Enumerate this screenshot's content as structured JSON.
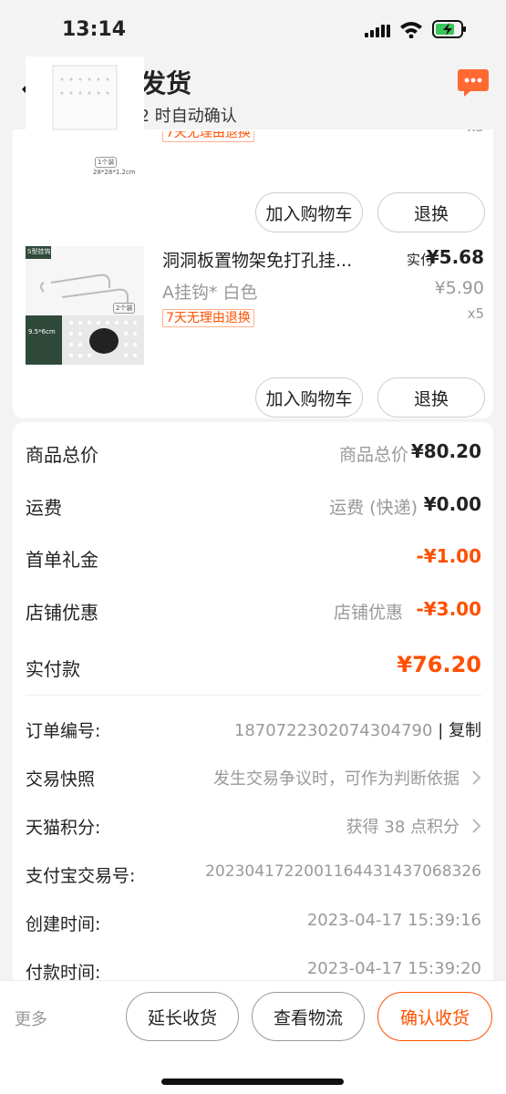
{
  "status_bar": {
    "time": "13:14"
  },
  "header": {
    "title": "卖家已发货",
    "subtitle": "还剩 9 天 2 时自动确认"
  },
  "items": [
    {
      "tag": "7天无理由退换",
      "qty": "x5",
      "thumb_caption_1": "1个装",
      "thumb_caption_2": "28*28*1.2cm",
      "add_cart": "加入购物车",
      "return": "退换"
    },
    {
      "name": "洞洞板置物架免打孔挂...",
      "variant": "A挂钩* 白色",
      "tag": "7天无理由退换",
      "paid_label": "实付",
      "paid": "¥5.68",
      "original": "¥5.90",
      "qty": "x5",
      "thumb_label": "S型挂钩",
      "thumb_size": "9.5*6cm",
      "thumb_count": "2个装",
      "add_cart": "加入购物车",
      "return": "退换"
    }
  ],
  "price_rows": [
    {
      "label": "商品总价",
      "mid": "商品总价",
      "value": "¥80.20"
    },
    {
      "label": "运费",
      "mid": "运费 (快递)",
      "value": "¥0.00"
    },
    {
      "label": "首单礼金",
      "mid": "",
      "value": "-¥1.00"
    },
    {
      "label": "店铺优惠",
      "mid": "店铺优惠",
      "value": "-¥3.00"
    }
  ],
  "total": {
    "label": "实付款",
    "value": "¥76.20"
  },
  "order_info": [
    {
      "label": "订单编号:",
      "value": "1870722302074304790",
      "action": "复制"
    },
    {
      "label": "交易快照",
      "value": "发生交易争议时，可作为判断依据"
    },
    {
      "label": "天猫积分:",
      "value": "获得 38 点积分"
    },
    {
      "label": "支付宝交易号:",
      "value": "2023041722001164431437068326"
    },
    {
      "label": "创建时间:",
      "value": "2023-04-17 15:39:16"
    },
    {
      "label": "付款时间:",
      "value": "2023-04-17 15:39:20"
    }
  ],
  "bottom_bar": {
    "more": "更多",
    "extend": "延长收货",
    "logistics": "查看物流",
    "confirm": "确认收货"
  },
  "colors": {
    "accent": "#ff5000",
    "bubble": "#ff6a33"
  },
  "icons": [
    "back-chevron-icon",
    "more-bubble-icon",
    "signal-icon",
    "wifi-icon",
    "battery-charging-icon",
    "chevron-right-icon"
  ]
}
